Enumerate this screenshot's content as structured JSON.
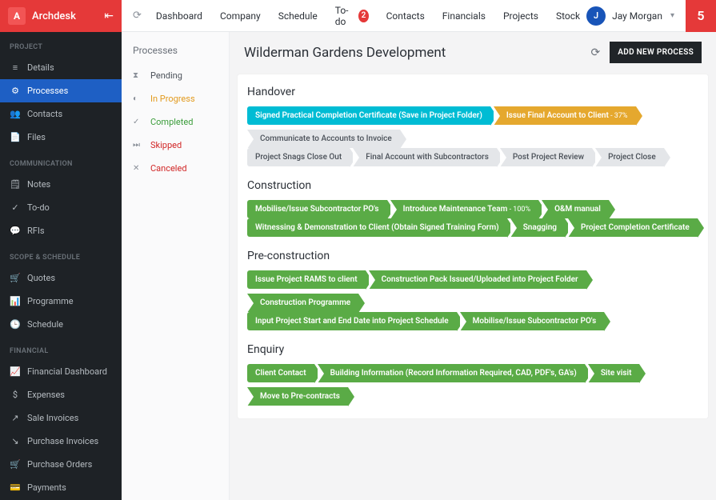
{
  "brand": {
    "logo_letter": "A",
    "name": "Archdesk"
  },
  "sidebar": {
    "sections": [
      {
        "title": "PROJECT",
        "items": [
          {
            "label": "Details",
            "icon": "≡"
          },
          {
            "label": "Processes",
            "icon": "⚙"
          },
          {
            "label": "Contacts",
            "icon": "👥"
          },
          {
            "label": "Files",
            "icon": "📄"
          }
        ]
      },
      {
        "title": "COMMUNICATION",
        "items": [
          {
            "label": "Notes",
            "icon": "🗒"
          },
          {
            "label": "To-do",
            "icon": "✓"
          },
          {
            "label": "RFIs",
            "icon": "💬"
          }
        ]
      },
      {
        "title": "SCOPE & SCHEDULE",
        "items": [
          {
            "label": "Quotes",
            "icon": "🛒"
          },
          {
            "label": "Programme",
            "icon": "📊"
          },
          {
            "label": "Schedule",
            "icon": "🕒"
          }
        ]
      },
      {
        "title": "FINANCIAL",
        "items": [
          {
            "label": "Financial Dashboard",
            "icon": "📈"
          },
          {
            "label": "Expenses",
            "icon": "$"
          },
          {
            "label": "Sale Invoices",
            "icon": "↗"
          },
          {
            "label": "Purchase Invoices",
            "icon": "↘"
          },
          {
            "label": "Purchase Orders",
            "icon": "🛒"
          },
          {
            "label": "Payments",
            "icon": "💳"
          }
        ]
      }
    ]
  },
  "topnav": {
    "items": [
      "Dashboard",
      "Company",
      "Schedule",
      "To-do",
      "Contacts",
      "Financials",
      "Projects",
      "Stock"
    ],
    "todo_badge": "2",
    "user": {
      "initial": "J",
      "name": "Jay Morgan"
    },
    "notif_count": "5"
  },
  "filters": {
    "title": "Processes",
    "items": [
      {
        "key": "pending",
        "label": "Pending",
        "icon": "⧗"
      },
      {
        "key": "inprogress",
        "label": "In Progress",
        "icon": "◐"
      },
      {
        "key": "completed",
        "label": "Completed",
        "icon": "✓"
      },
      {
        "key": "skipped",
        "label": "Skipped",
        "icon": "⏭"
      },
      {
        "key": "canceled",
        "label": "Canceled",
        "icon": "✕"
      }
    ]
  },
  "page": {
    "title": "Wilderman Gardens Development",
    "add_button": "ADD NEW PROCESS"
  },
  "processes": [
    {
      "title": "Handover",
      "rows": [
        [
          {
            "label": "Signed Practical Completion Certificate (Save in Project Folder)",
            "color": "cyan"
          },
          {
            "label": "Issue Final Account to Client",
            "pct": " - 37%",
            "color": "amber"
          },
          {
            "label": "Communicate to Accounts to Invoice",
            "color": "grey"
          }
        ],
        [
          {
            "label": "Project Snags Close Out",
            "color": "grey"
          },
          {
            "label": "Final Account with Subcontractors",
            "color": "grey"
          },
          {
            "label": "Post Project Review",
            "color": "grey"
          },
          {
            "label": "Project Close",
            "color": "grey"
          }
        ]
      ]
    },
    {
      "title": "Construction",
      "rows": [
        [
          {
            "label": "Mobilise/Issue Subcontractor PO's",
            "color": "green"
          },
          {
            "label": "Introduce Maintenance Team",
            "pct": " - 100%",
            "color": "green"
          },
          {
            "label": "O&M manual",
            "color": "green"
          }
        ],
        [
          {
            "label": "Witnessing & Demonstration to Client (Obtain Signed Training Form)",
            "color": "green"
          },
          {
            "label": "Snagging",
            "color": "green"
          },
          {
            "label": "Project Completion Certificate",
            "color": "green"
          }
        ]
      ]
    },
    {
      "title": "Pre-construction",
      "rows": [
        [
          {
            "label": "Issue Project RAMS to client",
            "color": "green"
          },
          {
            "label": "Construction Pack Issued/Uploaded into Project Folder",
            "color": "green"
          },
          {
            "label": "Construction Programme",
            "color": "green"
          }
        ],
        [
          {
            "label": "Input Project Start and End Date into Project Schedule",
            "color": "green"
          },
          {
            "label": "Mobilise/Issue Subcontractor PO's",
            "color": "green"
          }
        ]
      ]
    },
    {
      "title": "Enquiry",
      "rows": [
        [
          {
            "label": "Client Contact",
            "color": "green"
          },
          {
            "label": "Building Information (Record Information Required, CAD, PDF's, GA's)",
            "color": "green"
          },
          {
            "label": "Site visit",
            "color": "green"
          },
          {
            "label": "Move to Pre-contracts",
            "color": "green"
          }
        ]
      ]
    }
  ]
}
